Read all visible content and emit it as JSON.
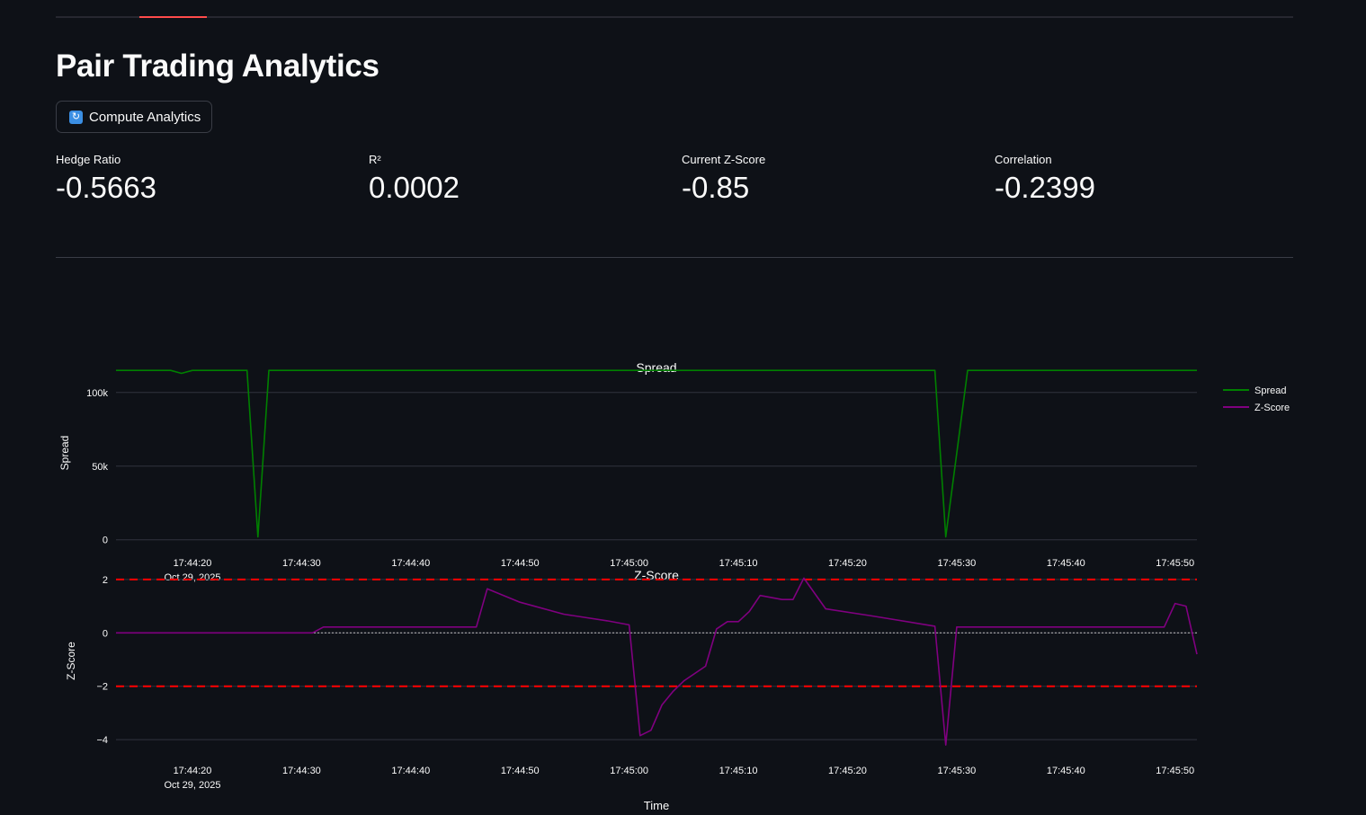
{
  "header": {
    "title": "Pair Trading Analytics",
    "compute_button_label": "Compute Analytics",
    "compute_button_icon": "refresh-icon"
  },
  "metrics": [
    {
      "label": "Hedge Ratio",
      "value": "-0.5663"
    },
    {
      "label": "R²",
      "value": "0.0002"
    },
    {
      "label": "Current Z-Score",
      "value": "-0.85"
    },
    {
      "label": "Correlation",
      "value": "-0.2399"
    }
  ],
  "chart_data": [
    {
      "type": "line",
      "title": "Spread",
      "ylabel": "Spread",
      "xlabel": "",
      "ylim": [
        -2000,
        120000
      ],
      "yticks": [
        0,
        50000,
        100000
      ],
      "ytick_labels": [
        "0",
        "50k",
        "100k"
      ],
      "xticks": [
        "17:44:20",
        "17:44:30",
        "17:44:40",
        "17:44:50",
        "17:45:00",
        "17:45:10",
        "17:45:20",
        "17:45:30",
        "17:45:40",
        "17:45:50"
      ],
      "xtick_date": "Oct 29, 2025",
      "grid": true,
      "legend": "top-right",
      "series": [
        {
          "name": "Spread",
          "color": "#008000",
          "points": [
            [
              "17:44:13",
              115000
            ],
            [
              "17:44:18",
              115000
            ],
            [
              "17:44:19",
              113000
            ],
            [
              "17:44:20",
              115000
            ],
            [
              "17:44:25",
              115000
            ],
            [
              "17:44:26",
              2000
            ],
            [
              "17:44:27",
              115000
            ],
            [
              "17:45:28",
              115000
            ],
            [
              "17:45:29",
              2000
            ],
            [
              "17:45:31",
              115000
            ],
            [
              "17:45:52",
              115000
            ]
          ]
        }
      ]
    },
    {
      "type": "line",
      "title": "Z-Score",
      "ylabel": "Z-Score",
      "xlabel": "Time",
      "ylim": [
        -4.4,
        2.3
      ],
      "yticks": [
        -4,
        -2,
        0,
        2
      ],
      "ytick_labels": [
        "−4",
        "−2",
        "0",
        "2"
      ],
      "xticks": [
        "17:44:20",
        "17:44:30",
        "17:44:40",
        "17:44:50",
        "17:45:00",
        "17:45:10",
        "17:45:20",
        "17:45:30",
        "17:45:40",
        "17:45:50"
      ],
      "xtick_date": "Oct 29, 2025",
      "grid": true,
      "reference_lines": [
        {
          "y": 2,
          "color": "#ff0000",
          "style": "dashed"
        },
        {
          "y": -2,
          "color": "#ff0000",
          "style": "dashed"
        },
        {
          "y": 0,
          "color": "#aaaaaa",
          "style": "dotted"
        }
      ],
      "series": [
        {
          "name": "Z-Score",
          "color": "#800080",
          "points": [
            [
              "17:44:13",
              0
            ],
            [
              "17:44:31",
              0
            ],
            [
              "17:44:32",
              0.22
            ],
            [
              "17:44:46",
              0.22
            ],
            [
              "17:44:47",
              1.65
            ],
            [
              "17:44:50",
              1.15
            ],
            [
              "17:44:54",
              0.7
            ],
            [
              "17:44:58",
              0.45
            ],
            [
              "17:45:00",
              0.3
            ],
            [
              "17:45:01",
              -3.85
            ],
            [
              "17:45:02",
              -3.65
            ],
            [
              "17:45:03",
              -2.7
            ],
            [
              "17:45:04",
              -2.2
            ],
            [
              "17:45:05",
              -1.8
            ],
            [
              "17:45:07",
              -1.25
            ],
            [
              "17:45:08",
              0.15
            ],
            [
              "17:45:09",
              0.42
            ],
            [
              "17:45:10",
              0.42
            ],
            [
              "17:45:11",
              0.8
            ],
            [
              "17:45:12",
              1.4
            ],
            [
              "17:45:14",
              1.25
            ],
            [
              "17:45:15",
              1.25
            ],
            [
              "17:45:16",
              2.05
            ],
            [
              "17:45:18",
              0.9
            ],
            [
              "17:45:22",
              0.65
            ],
            [
              "17:45:28",
              0.25
            ],
            [
              "17:45:29",
              -4.2
            ],
            [
              "17:45:30",
              0.22
            ],
            [
              "17:45:49",
              0.22
            ],
            [
              "17:45:50",
              1.1
            ],
            [
              "17:45:51",
              1.0
            ],
            [
              "17:45:52",
              -0.8
            ]
          ]
        }
      ]
    }
  ]
}
